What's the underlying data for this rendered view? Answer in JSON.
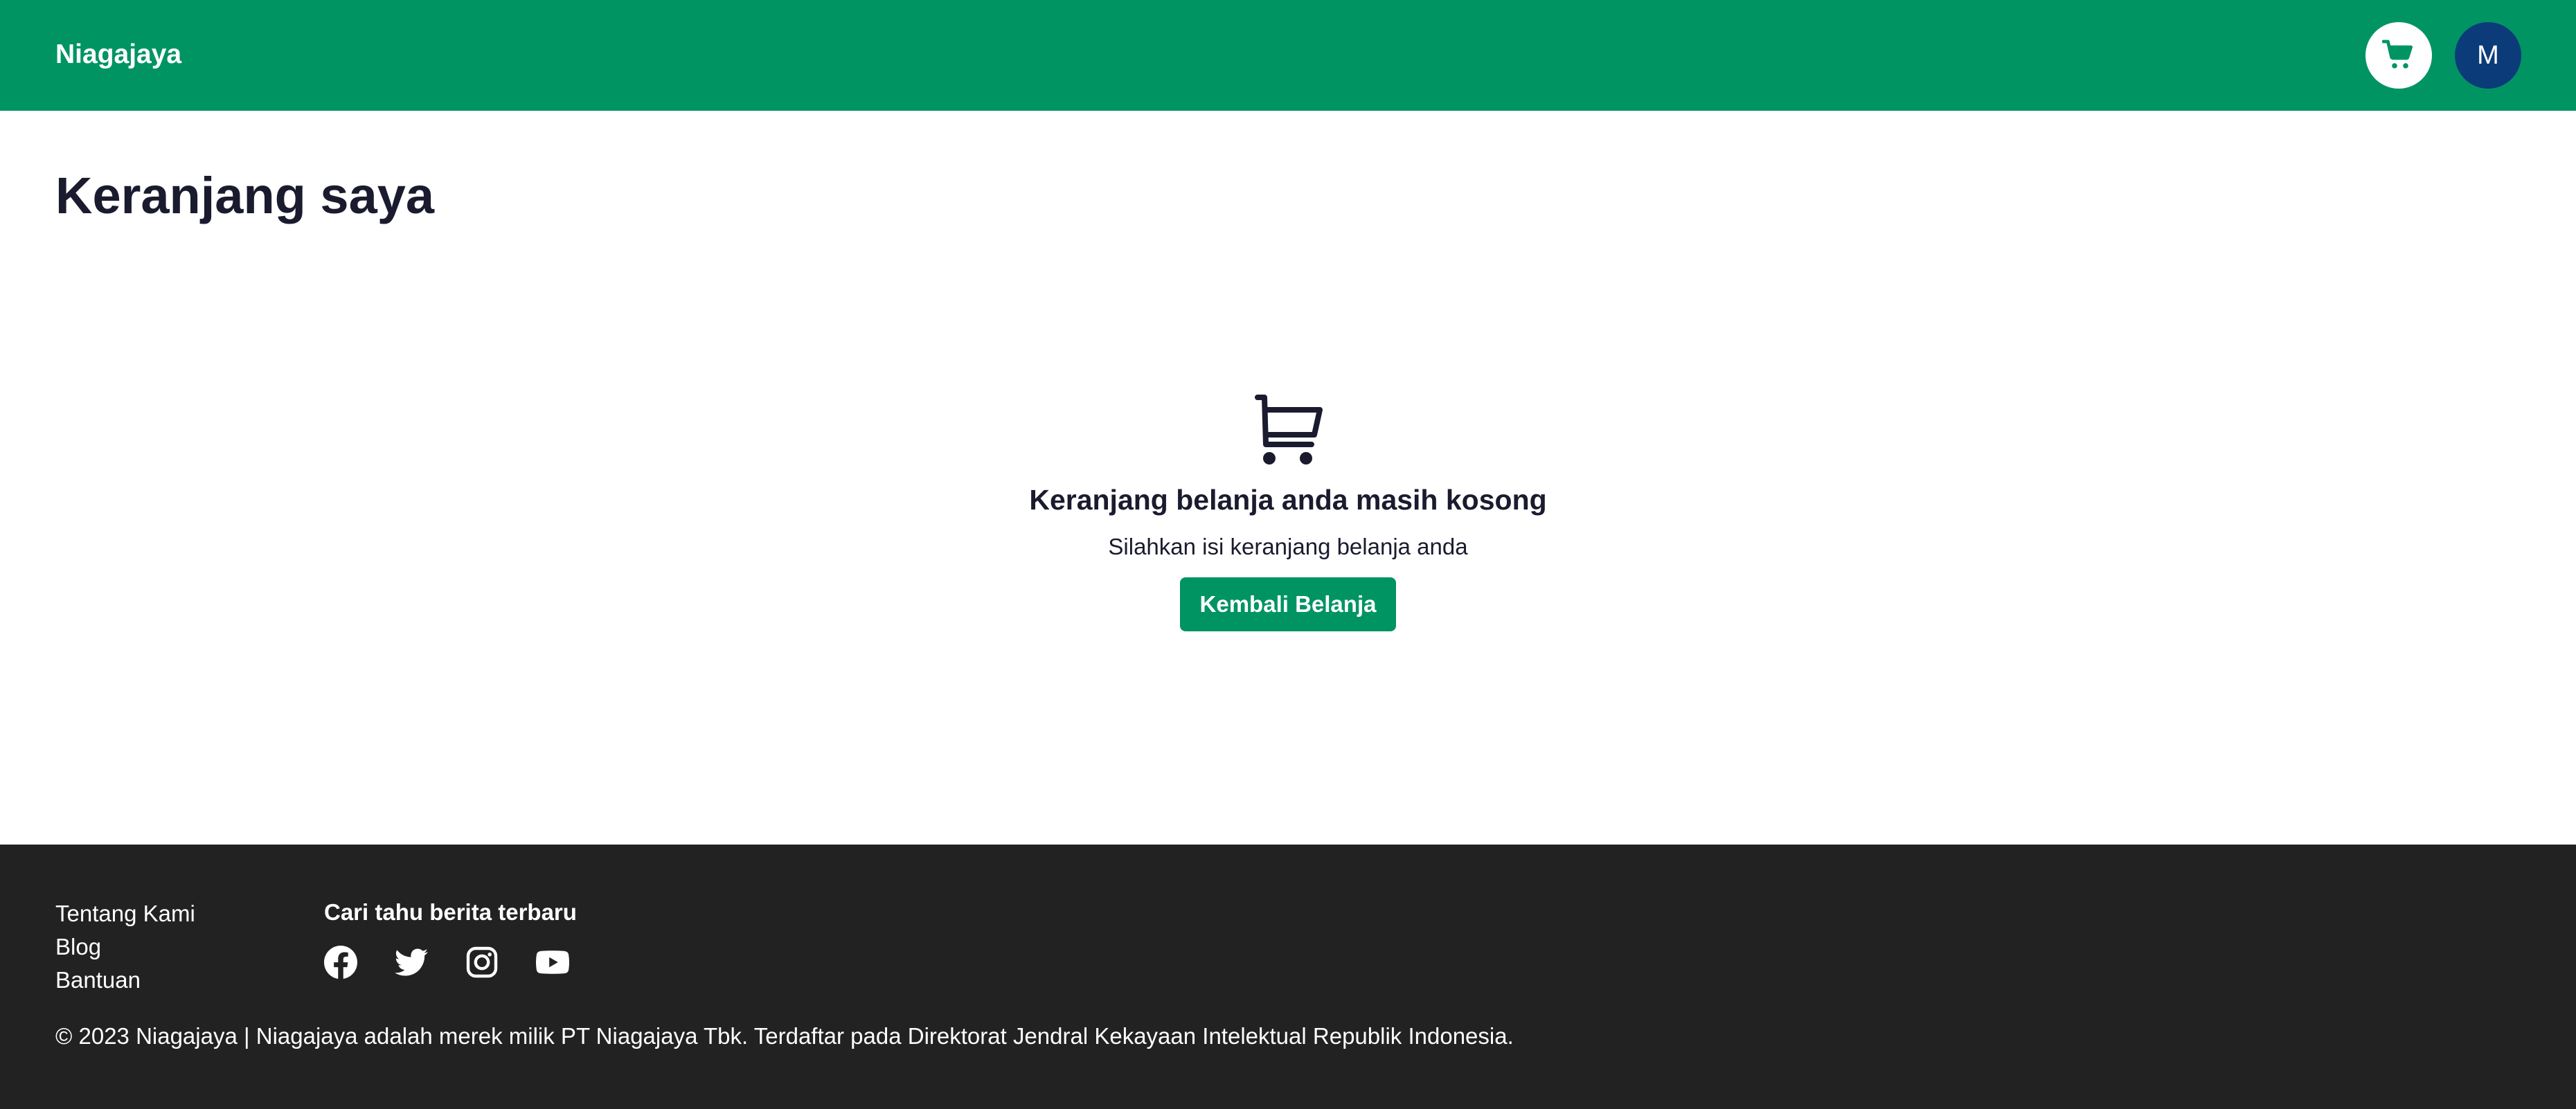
{
  "header": {
    "brand": "Niagajaya",
    "cart_icon": "shopping-cart-icon",
    "avatar_initial": "M"
  },
  "main": {
    "title": "Keranjang saya",
    "empty_icon": "empty-cart-icon",
    "empty_heading": "Keranjang belanja anda masih kosong",
    "empty_subtext": "Silahkan isi keranjang belanja anda",
    "back_button": "Kembali Belanja"
  },
  "footer": {
    "links": [
      "Tentang Kami",
      "Blog",
      "Bantuan"
    ],
    "news_title": "Cari tahu berita terbaru",
    "social_icons": [
      "facebook-icon",
      "twitter-icon",
      "instagram-icon",
      "youtube-icon"
    ],
    "copyright": "© 2023 Niagajaya | Niagajaya adalah merek milik PT Niagajaya Tbk. Terdaftar pada Direktorat Jendral Kekayaan Intelektual Republik Indonesia."
  },
  "colors": {
    "brand_green": "#009463",
    "avatar_blue": "#0c3b7a",
    "footer_bg": "#222222",
    "text_dark": "#1a1b2e"
  }
}
